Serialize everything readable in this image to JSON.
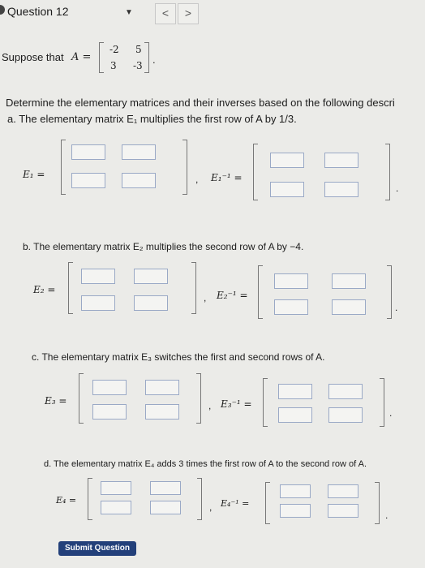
{
  "header": {
    "title": "Question 12",
    "dropdown_icon": "▼",
    "prev": "<",
    "next": ">"
  },
  "problem": {
    "intro": "Suppose that",
    "var": "A =",
    "matrix": [
      "-2",
      "5",
      "3",
      "-3"
    ],
    "period": ".",
    "instruction": "Determine the elementary matrices and their inverses based on the following descri"
  },
  "parts": [
    {
      "text": "a. The elementary matrix E₁ multiplies the first row of A by 1/3.",
      "label": "E₁ =",
      "inv_label": "E₁⁻¹ ="
    },
    {
      "text": "b. The elementary matrix E₂ multiplies the second row of A by −4.",
      "label": "E₂ =",
      "inv_label": "E₂⁻¹ ="
    },
    {
      "text": "c. The elementary matrix E₃ switches the first and second rows of A.",
      "label": "E₃ =",
      "inv_label": "E₃⁻¹ ="
    },
    {
      "text": "d. The elementary matrix E₄ adds 3 times the first row of A to the second row of A.",
      "label": "E₄ =",
      "inv_label": "E₄⁻¹ ="
    }
  ],
  "comma": ",",
  "period": ".",
  "submit_label": "Submit Question"
}
